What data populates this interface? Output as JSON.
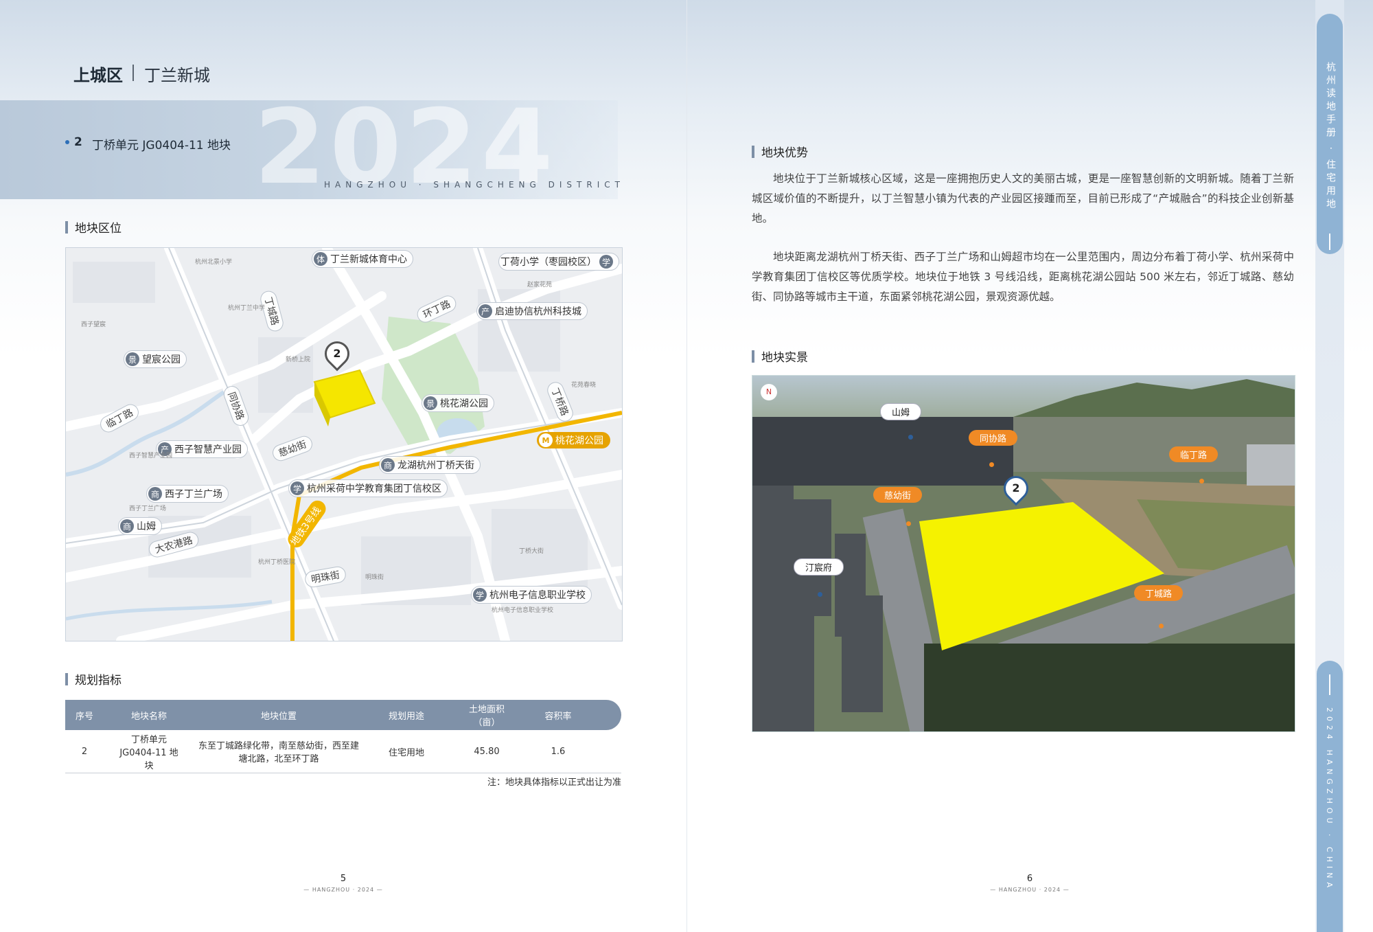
{
  "header": {
    "district": "上城区",
    "area": "丁兰新城"
  },
  "banner": {
    "year": "2024",
    "subtitle": "HANGZHOU · SHANGCHENG DISTRICT",
    "parcel_no": "2",
    "parcel_name": "丁桥单元 JG0404-11 地块"
  },
  "sections": {
    "location": "地块区位",
    "planning": "规划指标",
    "advantages": "地块优势",
    "realview": "地块实景"
  },
  "map": {
    "pin": "2",
    "pois": [
      {
        "icon": "体",
        "label": "丁兰新城体育中心"
      },
      {
        "icon": "学",
        "label": "丁荷小学（枣园校区）"
      },
      {
        "icon": "产",
        "label": "启迪协信杭州科技城"
      },
      {
        "icon": "景",
        "label": "望宸公园"
      },
      {
        "icon": "景",
        "label": "桃花湖公园"
      },
      {
        "icon": "产",
        "label": "西子智慧产业园"
      },
      {
        "icon": "商",
        "label": "龙湖杭州丁桥天街"
      },
      {
        "icon": "学",
        "label": "杭州采荷中学教育集团丁信校区"
      },
      {
        "icon": "商",
        "label": "西子丁兰广场"
      },
      {
        "icon": "商",
        "label": "山姆"
      },
      {
        "icon": "学",
        "label": "杭州电子信息职业学校"
      }
    ],
    "roads": [
      "丁城路",
      "环丁路",
      "同协路",
      "临丁路",
      "慈幼街",
      "大农港路",
      "明珠街",
      "丁桥路"
    ],
    "metro_line": "地铁3号线",
    "metro_station": "桃花湖公园",
    "metro_icon": "M",
    "minor": [
      "杭州北景小学",
      "杭州丁兰中学",
      "西子智慧产业园",
      "西子丁兰广场",
      "杭州电子信息职业学校",
      "新桥上院",
      "西子望宸",
      "明珠街",
      "丁桥大街",
      "杭州丁桥医院",
      "花苑春晓",
      "赵家花苑"
    ]
  },
  "table": {
    "headers": [
      "序号",
      "地块名称",
      "地块位置",
      "规划用途",
      "土地面积（亩）",
      "容积率"
    ],
    "rows": [
      {
        "no": "2",
        "name": "丁桥单元 JG0404-11 地块",
        "location": "东至丁城路绿化带，南至慈幼街，西至建塘北路，北至环丁路",
        "use": "住宅用地",
        "area": "45.80",
        "far": "1.6"
      }
    ],
    "note": "注：地块具体指标以正式出让为准"
  },
  "paragraphs": [
    "地块位于丁兰新城核心区域，这是一座拥抱历史人文的美丽古城，更是一座智慧创新的文明新城。随着丁兰新城区域价值的不断提升，以丁兰智慧小镇为代表的产业园区接踵而至，目前已形成了“产城融合”的科技企业创新基地。",
    "地块距离龙湖杭州丁桥天街、西子丁兰广场和山姆超市均在一公里范围内，周边分布着丁荷小学、杭州采荷中学教育集团丁信校区等优质学校。地块位于地铁 3 号线沿线，距离桃花湖公园站 500 米左右，邻近丁城路、慈幼街、同协路等城市主干道，东面紧邻桃花湖公园，景观资源优越。"
  ],
  "photo": {
    "pin": "2",
    "compass": "N",
    "tags_white": [
      "山姆",
      "汀宸府"
    ],
    "tags_orange": [
      "同协路",
      "临丁路",
      "慈幼街",
      "丁城路"
    ]
  },
  "footer": {
    "left_page": "5",
    "right_page": "6",
    "sub_left": "— HANGZHOU · 2024 —",
    "sub_right": "— HANGZHOU · 2024 —"
  },
  "sidetab": {
    "top": "杭州读地手册 · 住宅用地",
    "bottom": "2024 HANGZHOU · CHINA"
  },
  "colors": {
    "accent": "#7f91a8",
    "parcel": "#f5e600",
    "orange": "#f08a25",
    "tab": "#8fb3d4"
  }
}
